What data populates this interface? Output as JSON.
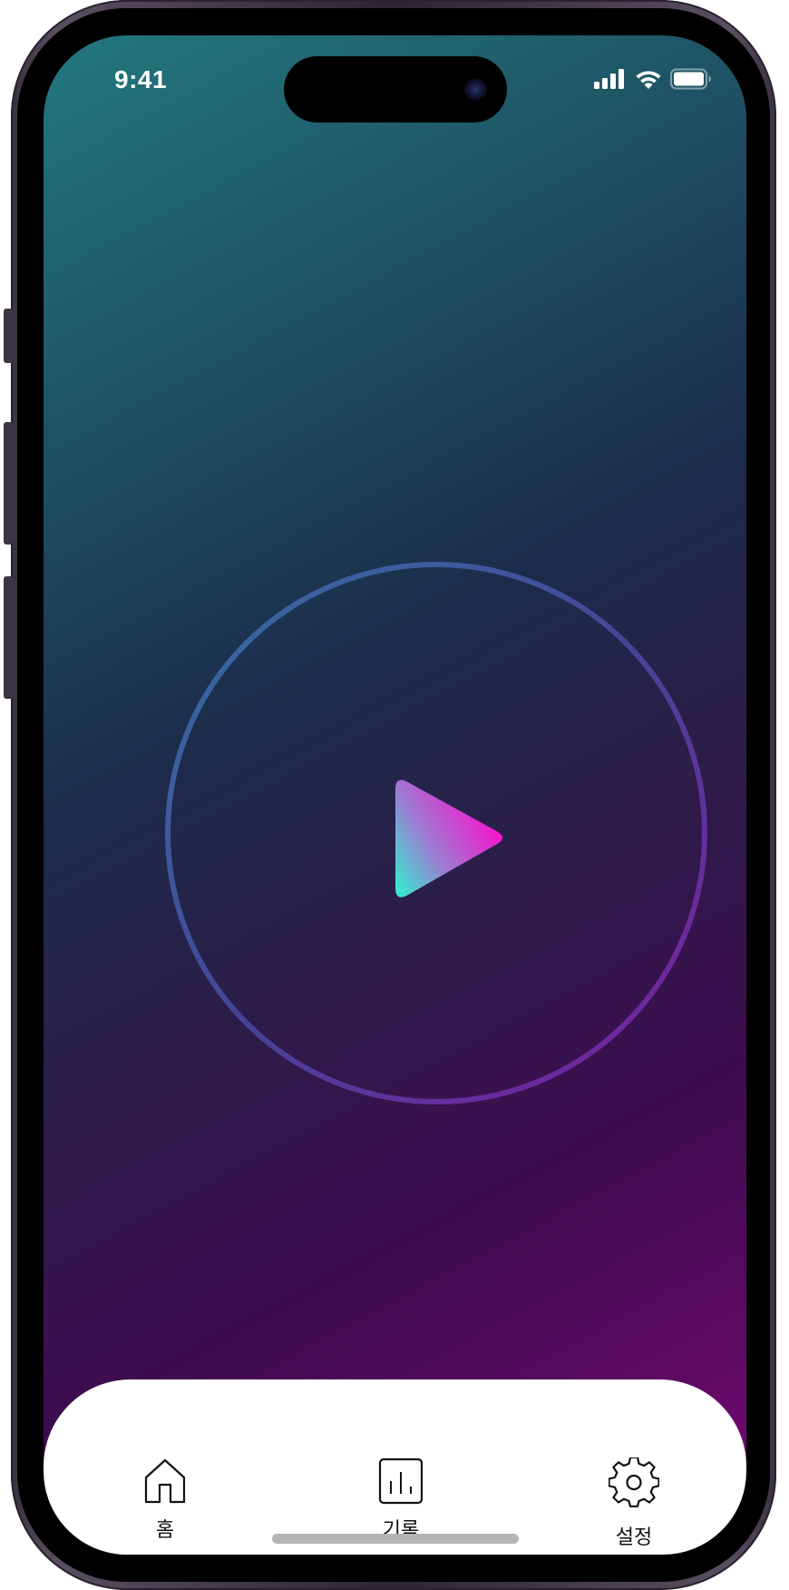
{
  "status_bar": {
    "time": "9:41",
    "icons": [
      "cellular-signal-icon",
      "wifi-icon",
      "battery-icon"
    ]
  },
  "main": {
    "play_button_icon": "play-icon",
    "ring_colors": [
      "#3c73a8",
      "#7a1fa8"
    ],
    "play_gradient": [
      "#2ef2d2",
      "#ff0acb"
    ]
  },
  "tab_bar": {
    "tabs": [
      {
        "label": "홈",
        "icon": "home-icon"
      },
      {
        "label": "기록",
        "icon": "bar-chart-icon"
      },
      {
        "label": "설정",
        "icon": "gear-icon"
      }
    ]
  }
}
